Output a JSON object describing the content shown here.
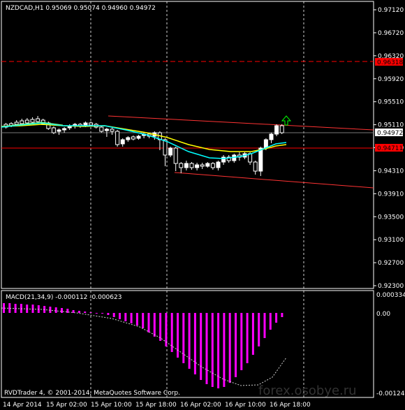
{
  "chart": {
    "symbol_header": "NZDCAD,H1  0.95069 0.95074 0.94960 0.94972",
    "price_axis_ticks": [
      "0.97120",
      "0.96720",
      "0.96320",
      "0.95920",
      "0.95510",
      "0.95110",
      "0.94700",
      "0.94310",
      "0.93910",
      "0.93500",
      "0.93100",
      "0.92700",
      "0.92300"
    ],
    "current_price": "0.94972",
    "red_line_prices": [
      "0.96318",
      "0.94711"
    ],
    "time_axis_labels": [
      "14 Apr 2014",
      "15 Apr 02:00",
      "15 Apr 10:00",
      "15 Apr 18:00",
      "16 Apr 02:00",
      "16 Apr 10:00",
      "16 Apr 18:00"
    ],
    "copyright": "RVDTrader 4, © 2001-2014, MetaQuotes Software Corp.",
    "watermark": "forex.osobye.ru"
  },
  "macd": {
    "header": "MACD(21,34,9) -0.000112 -0.000623",
    "axis_ticks": [
      "0.000334",
      "0.00",
      "-0.001248"
    ]
  },
  "colors": {
    "background": "#000000",
    "axis": "#ffffff",
    "bull_candle": "#ffffff",
    "bear_candle": "#000000",
    "ma_fast": "#00ffff",
    "ma_slow": "#ffff00",
    "red_line": "#ff0000",
    "macd_hist": "#ff00ff",
    "signal_arrow": "#00ff00"
  },
  "icons": {
    "signal_arrow": "up-arrow-icon"
  }
}
